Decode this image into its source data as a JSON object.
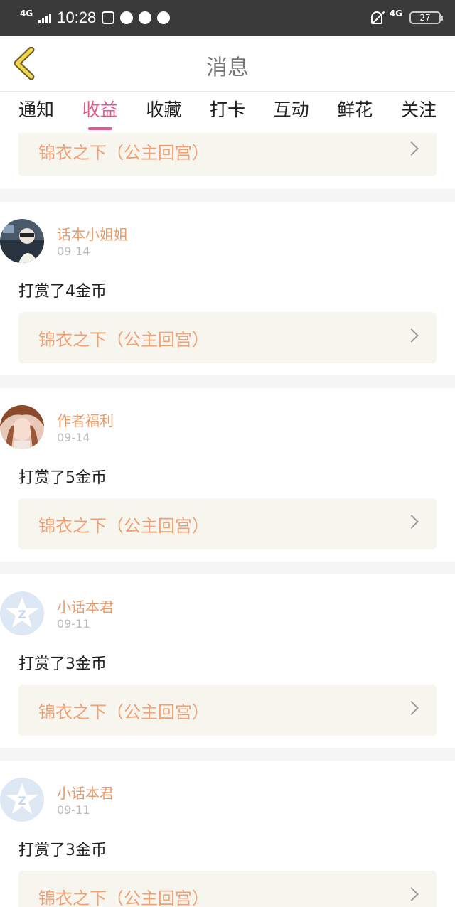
{
  "status": {
    "network": "4G",
    "time": "10:28",
    "battery": "27",
    "network_right": "4G"
  },
  "header": {
    "title": "消息"
  },
  "tabs": [
    {
      "label": "通知"
    },
    {
      "label": "收益"
    },
    {
      "label": "收藏"
    },
    {
      "label": "打卡"
    },
    {
      "label": "互动"
    },
    {
      "label": "鲜花"
    },
    {
      "label": "关注"
    }
  ],
  "active_tab": "收益",
  "top_partial": {
    "book": "锦衣之下（公主回宫）"
  },
  "messages": [
    {
      "user": "话本小姐姐",
      "date": "09-14",
      "action": "打赏了4金币",
      "book": "锦衣之下（公主回宫）"
    },
    {
      "user": "作者福利",
      "date": "09-14",
      "action": "打赏了5金币",
      "book": "锦衣之下（公主回宫）"
    },
    {
      "user": "小话本君",
      "date": "09-11",
      "action": "打赏了3金币",
      "book": "锦衣之下（公主回宫）"
    },
    {
      "user": "小话本君",
      "date": "09-11",
      "action": "打赏了3金币",
      "book": "锦衣之下（公主回宫）"
    }
  ],
  "colors": {
    "accent": "#e05a8c",
    "username": "#e89a68",
    "book_title": "#f0a074",
    "book_bg": "#f6f5ee"
  }
}
